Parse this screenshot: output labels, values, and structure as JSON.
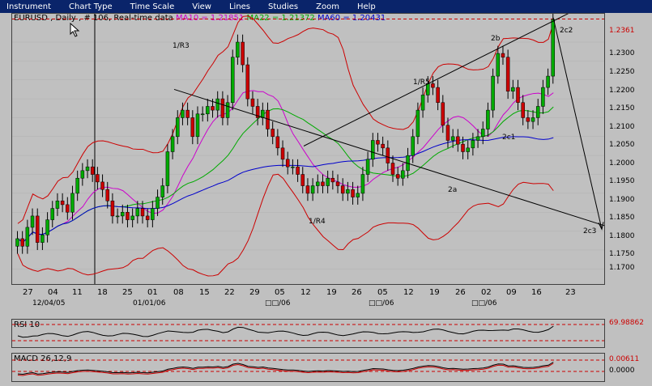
{
  "menu": [
    "Instrument",
    "Chart Type",
    "Time Scale",
    "View",
    "Lines",
    "Studies",
    "Zoom",
    "Help"
  ],
  "header": {
    "symbol": "EURUSD , Daily , # 106, Real-time data",
    "ma10": "MA10 = 1.21851",
    "ma22": "MA22 = 1.21372",
    "ma60": "MA60 = 1.20431"
  },
  "colors": {
    "ma10": "#cc00cc",
    "ma22": "#00aa00",
    "ma60": "#0000cc",
    "bollinger": "#cc0000",
    "bull": "#00aa00",
    "bear": "#cc0000"
  },
  "price_axis": {
    "current": "1.2361",
    "labels": [
      "1.2300",
      "1.2250",
      "1.2200",
      "1.2150",
      "1.2100",
      "1.2050",
      "1.2000",
      "1.1950",
      "1.1900",
      "1.1850",
      "1.1800",
      "1.1750",
      "1.1700"
    ]
  },
  "time_axis": {
    "ticks": [
      "27",
      "04",
      "11",
      "18",
      "25",
      "01",
      "08",
      "15",
      "22",
      "29",
      "05",
      "12",
      "19",
      "26",
      "05",
      "12",
      "19",
      "26",
      "02",
      "09",
      "16",
      "23"
    ],
    "months": [
      "12/04/05",
      "01/01/06",
      "□□/06",
      "□□/06",
      "□□/06"
    ]
  },
  "annotations": [
    "1/R3",
    "1/R5",
    "1/R4",
    "2b",
    "2c1",
    "2c2",
    "2a",
    "2c3"
  ],
  "rsi": {
    "label": "RSI 10",
    "value": "69.98862"
  },
  "macd": {
    "label": "MACD 26,12,9",
    "value1": "0.00611",
    "value2": "0.0000"
  },
  "chart_data": {
    "type": "candlestick",
    "title": "EURUSD , Daily , # 106, Real-time data",
    "ylim": [
      1.166,
      1.2375
    ],
    "bar_closes": [
      1.178,
      1.176,
      1.181,
      1.184,
      1.177,
      1.179,
      1.183,
      1.186,
      1.188,
      1.187,
      1.185,
      1.19,
      1.194,
      1.196,
      1.197,
      1.195,
      1.193,
      1.191,
      1.188,
      1.184,
      1.184,
      1.185,
      1.183,
      1.184,
      1.186,
      1.184,
      1.183,
      1.186,
      1.189,
      1.192,
      1.201,
      1.205,
      1.21,
      1.212,
      1.21,
      1.205,
      1.211,
      1.211,
      1.213,
      1.212,
      1.215,
      1.21,
      1.214,
      1.226,
      1.23,
      1.224,
      1.215,
      1.213,
      1.21,
      1.212,
      1.207,
      1.205,
      1.202,
      1.199,
      1.197,
      1.197,
      1.195,
      1.192,
      1.19,
      1.192,
      1.193,
      1.192,
      1.194,
      1.193,
      1.192,
      1.19,
      1.191,
      1.189,
      1.19,
      1.195,
      1.199,
      1.204,
      1.203,
      1.202,
      1.198,
      1.195,
      1.194,
      1.196,
      1.2,
      1.205,
      1.212,
      1.216,
      1.219,
      1.218,
      1.214,
      1.208,
      1.204,
      1.205,
      1.203,
      1.201,
      1.202,
      1.204,
      1.205,
      1.207,
      1.212,
      1.221,
      1.227,
      1.226,
      1.217,
      1.218,
      1.214,
      1.21,
      1.209,
      1.21,
      1.213,
      1.218,
      1.221,
      1.236
    ]
  }
}
